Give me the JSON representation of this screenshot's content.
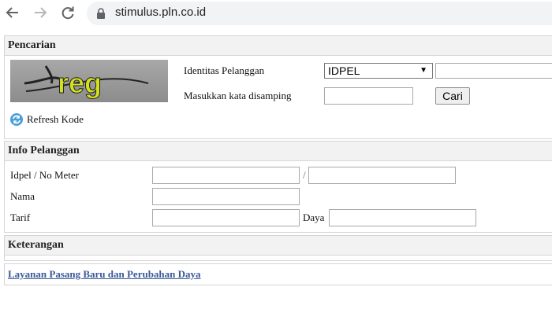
{
  "browser": {
    "url": "stimulus.pln.co.id",
    "icons": [
      "back-icon",
      "forward-icon",
      "reload-icon",
      "lock-icon"
    ]
  },
  "pencarian": {
    "title": "Pencarian",
    "identitas_label": "Identitas Pelanggan",
    "idpel_selected": "IDPEL",
    "masukkan_label": "Masukkan kata disamping",
    "cari_label": "Cari",
    "refresh_label": "Refresh Kode",
    "captcha_text": "reg"
  },
  "info": {
    "title": "Info Pelanggan",
    "idpel_label": "Idpel / No Meter",
    "slash": "/",
    "nama_label": "Nama",
    "tarif_label": "Tarif",
    "daya_label": "Daya"
  },
  "keterangan": {
    "title": "Keterangan"
  },
  "layanan": {
    "link_text": "Layanan Pasang Baru dan Perubahan Daya"
  },
  "colors": {
    "link": "#3b5998",
    "panel_header": "#f2f2f2",
    "captcha_text": "#d4e21e"
  }
}
